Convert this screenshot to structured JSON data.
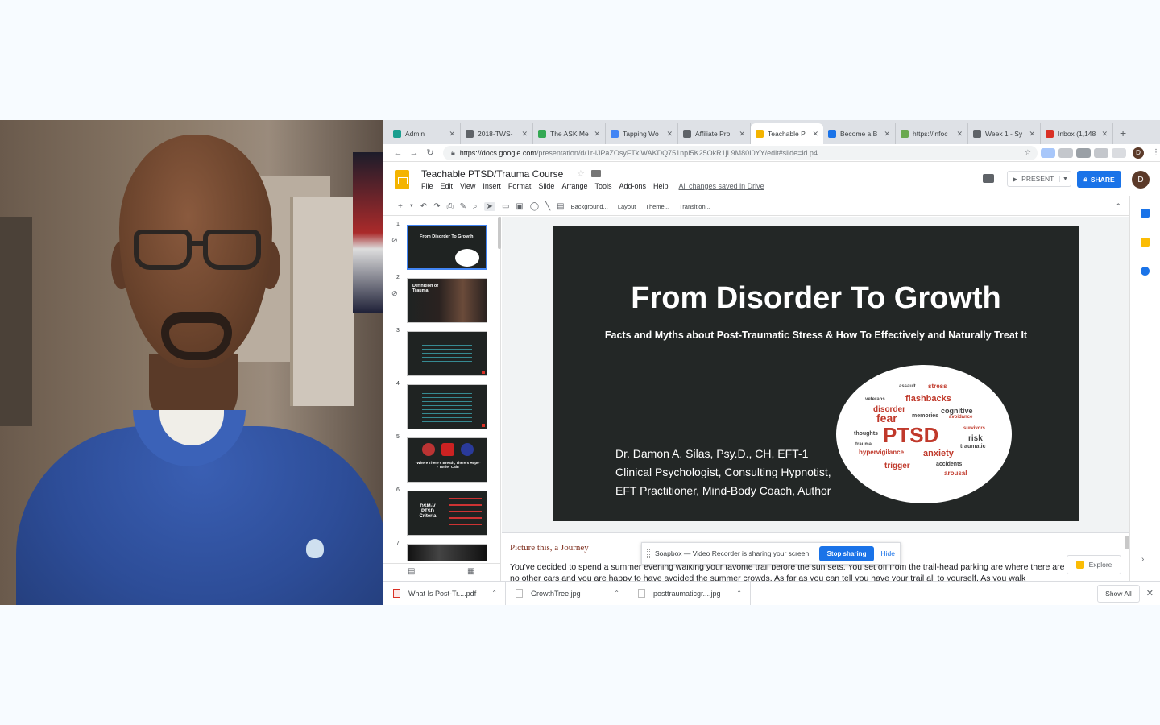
{
  "tabs": [
    {
      "label": "Admin",
      "color": "#1a9e8f"
    },
    {
      "label": "2018-TWS-",
      "color": "#5f6368"
    },
    {
      "label": "The ASK Me",
      "color": "#34a853"
    },
    {
      "label": "Tapping Wo",
      "color": "#4285f4"
    },
    {
      "label": "Affiliate Pro",
      "color": "#5f6368"
    },
    {
      "label": "Teachable P",
      "color": "#f4b400"
    },
    {
      "label": "Become a B",
      "color": "#1a73e8"
    },
    {
      "label": "https://infoc",
      "color": "#6aa84f"
    },
    {
      "label": "Week 1 - Sy",
      "color": "#5f6368"
    },
    {
      "label": "Inbox (1,148",
      "color": "#d93025"
    }
  ],
  "address": {
    "host": "https://docs.google.com",
    "path": "/presentation/d/1r-lJPaZOsyFTkiWAKDQ751npI5K25OkR1jL9M80I0YY/edit#slide=id.p4"
  },
  "doc": {
    "title": "Teachable PTSD/Trauma Course",
    "menus": [
      "File",
      "Edit",
      "View",
      "Insert",
      "Format",
      "Slide",
      "Arrange",
      "Tools",
      "Add-ons",
      "Help"
    ],
    "saved_status": "All changes saved in Drive",
    "present_label": "PRESENT",
    "share_label": "SHARE",
    "avatar_letter": "D"
  },
  "toolbar": {
    "background": "Background...",
    "layout": "Layout",
    "theme": "Theme...",
    "transition": "Transition..."
  },
  "filmstrip": [
    {
      "num": "1",
      "title": "From Disorder To Growth"
    },
    {
      "num": "2",
      "title": "Definition of Trauma"
    },
    {
      "num": "3",
      "title": ""
    },
    {
      "num": "4",
      "title": ""
    },
    {
      "num": "5",
      "title": "\"Where There's Breath, There's Hope\" - Tonier Cain"
    },
    {
      "num": "6",
      "title": "DSM-V PTSD Criteria"
    },
    {
      "num": "7",
      "title": ""
    }
  ],
  "slide": {
    "title": "From Disorder To Growth",
    "subtitle": "Facts and Myths about Post-Traumatic Stress & How To Effectively and Naturally Treat It",
    "author_line1": "Dr. Damon A. Silas, Psy.D., CH, EFT-1",
    "author_line2": "Clinical Psychologist, Consulting Hypnotist,",
    "author_line3": "EFT Practitioner, Mind-Body Coach, Author",
    "cloud_words": {
      "center": "PTSD",
      "fear": "fear",
      "flashbacks": "flashbacks",
      "anxiety": "anxiety",
      "risk": "risk",
      "disorder": "disorder",
      "trigger": "trigger",
      "arousal": "arousal",
      "cognitive": "cognitive",
      "hypervigilance": "hypervigilance",
      "stress": "stress",
      "traumatic": "traumatic",
      "survivors": "survivors",
      "memories": "memories",
      "avoidance": "avoidance",
      "thoughts": "thoughts",
      "trauma": "trauma",
      "accidents": "accidents",
      "veterans": "veterans",
      "assault": "assault"
    }
  },
  "notes": {
    "title": "Picture this, a Journey",
    "body": "You've decided to spend a summer evening walking your favorite trail before the sun sets. You set off from the trail-head parking are where there are no other cars and you are happy to have avoided the summer crowds. As far as you can tell you have your trail all to yourself. As you walk"
  },
  "share_bar": {
    "message": "Soapbox — Video Recorder is sharing your screen.",
    "stop_label": "Stop sharing",
    "hide_label": "Hide"
  },
  "explore_label": "Explore",
  "downloads": {
    "items": [
      "What Is Post-Tr....pdf",
      "GrowthTree.jpg",
      "posttraumaticgr....jpg"
    ],
    "show_all": "Show All"
  }
}
